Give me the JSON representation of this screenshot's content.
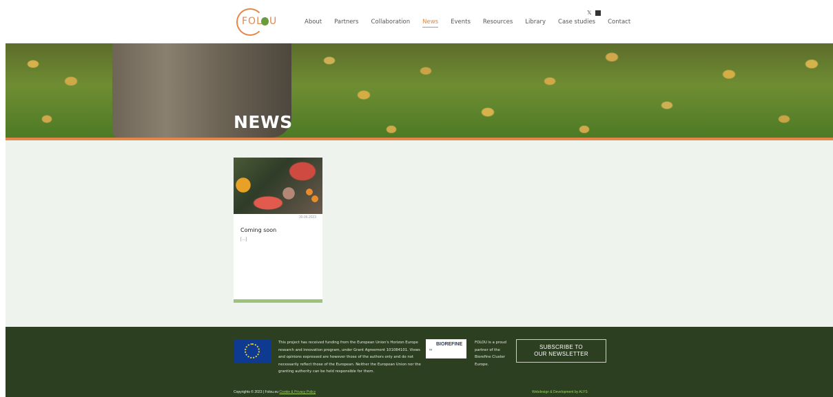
{
  "header": {
    "logo_text": "FOL",
    "logo_end": "U",
    "nav": [
      "About",
      "Partners",
      "Collaboration",
      "News",
      "Events",
      "Resources",
      "Library",
      "Case studies",
      "Contact"
    ],
    "active_nav": "News",
    "social": [
      "twitter-icon",
      "linkedin-icon"
    ]
  },
  "hero": {
    "title": "NEWS"
  },
  "posts": [
    {
      "date": "30.06.2023",
      "title": "Coming soon",
      "excerpt": "[…]"
    }
  ],
  "footer": {
    "funding_text": "This project has received funding from the European Union's Horizon Europe research and innovation program, under Grant Agreement 101084101. Views and opinions expressed are however those of the authors only and do not necessarily reflect those of the European. Neither the European Union nor the granting authority can be held responsible for them.",
    "biorefine_logo_text": "BIOREFINE",
    "partner_text": "FOLOU is a proud partner of the Biorefine Cluster Europe.",
    "subscribe_line1": "SUBSCRIBE TO",
    "subscribe_line2": "OUR NEWSLETTER",
    "copyright": "Copyrights © 2023 | Folou.eu",
    "copyright_link": "Cookie & Privacy Policy",
    "webdesign": "Webdesign & Development by ALYS"
  },
  "colors": {
    "accent": "#e3874a",
    "footer_bg": "#2c3f21",
    "content_bg": "#eef3ee",
    "card_bar": "#9dc27a"
  }
}
